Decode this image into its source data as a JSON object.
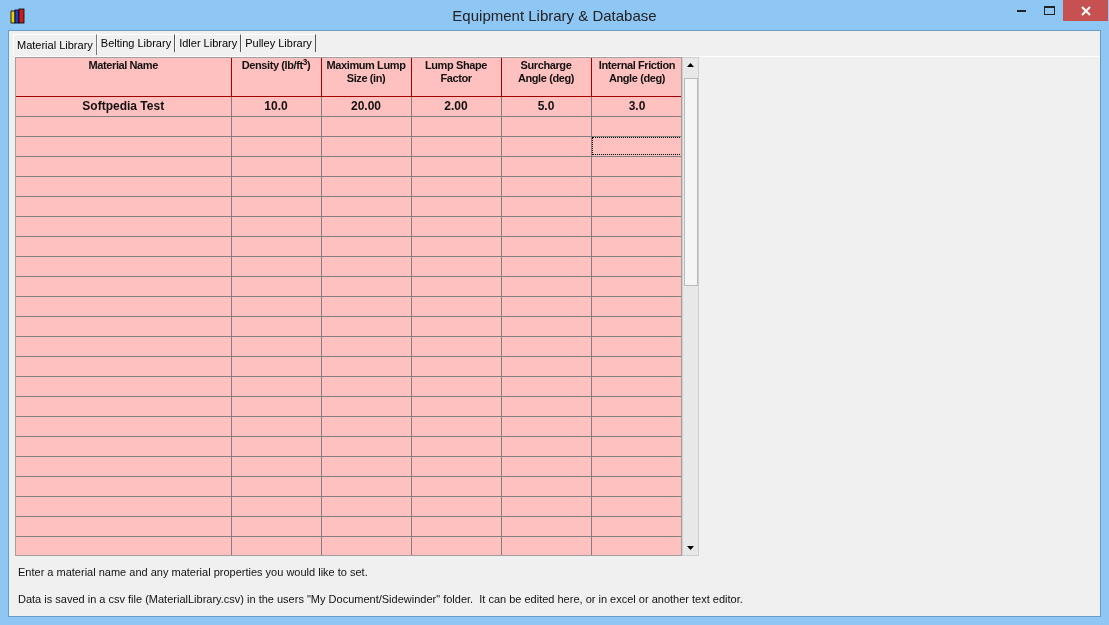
{
  "window": {
    "title": "Equipment Library & Database"
  },
  "tabs": [
    {
      "label": "Material Library",
      "selected": true
    },
    {
      "label": "Belting Library",
      "selected": false
    },
    {
      "label": "Idler Library",
      "selected": false
    },
    {
      "label": "Pulley Library",
      "selected": false
    }
  ],
  "table": {
    "columns": [
      "Material Name",
      "Density (lb/ft$^{3}$)",
      "Maximum Lump Size (in)",
      "Lump Shape Factor",
      "Surcharge Angle (deg)",
      "Internal Friction Angle (deg)"
    ],
    "rows": [
      {
        "cells": [
          "Softpedia Test",
          "10.0",
          "20.00",
          "2.00",
          "5.0",
          "3.0"
        ],
        "focused": false
      },
      {
        "focused": false
      },
      {
        "focused": true
      },
      {
        "focused": false
      },
      {
        "focused": false
      },
      {
        "focused": false
      },
      {
        "focused": false
      },
      {
        "focused": false
      },
      {
        "focused": false
      },
      {
        "focused": false
      },
      {
        "focused": false
      },
      {
        "focused": false
      },
      {
        "focused": false
      },
      {
        "focused": false
      },
      {
        "focused": false
      },
      {
        "focused": false
      },
      {
        "focused": false
      },
      {
        "focused": false
      },
      {
        "focused": false
      },
      {
        "focused": false
      },
      {
        "focused": false
      },
      {
        "focused": false
      },
      {
        "focused": false
      }
    ]
  },
  "notes": [
    "Enter a material name and any material properties you would like to set.",
    "Data is saved in a csv file (MaterialLibrary.csv) in the users \"My Document/Sidewinder\" folder.  It can be edited here, or in excel or another text editor."
  ]
}
